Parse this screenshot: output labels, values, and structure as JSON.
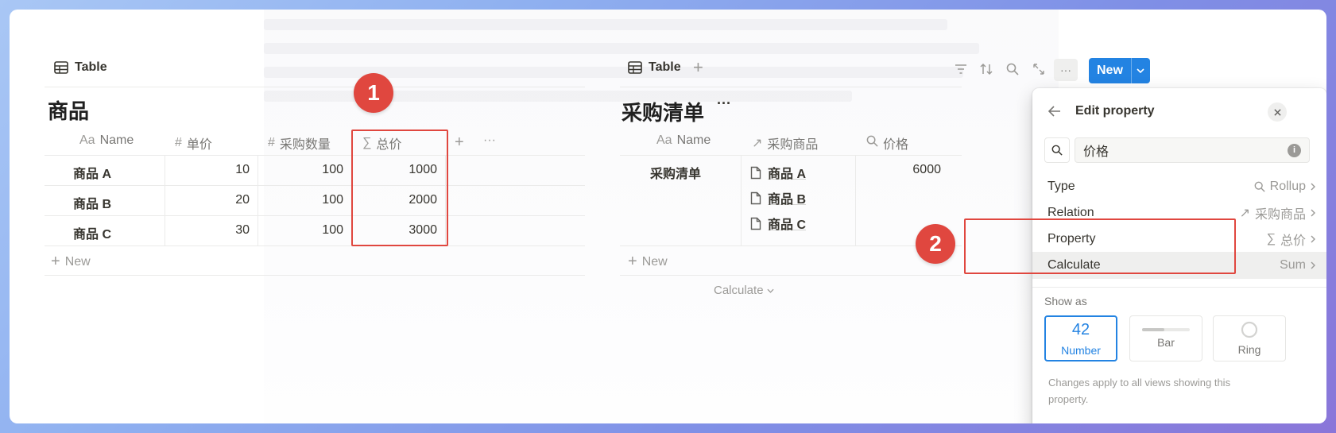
{
  "left": {
    "view_tab": "Table",
    "title": "商品",
    "columns": [
      {
        "icon": "Aa",
        "label": "Name"
      },
      {
        "icon": "#",
        "label": "单价"
      },
      {
        "icon": "#",
        "label": "采购数量"
      },
      {
        "icon": "∑",
        "label": "总价"
      }
    ],
    "rows": [
      {
        "name": "商品 A",
        "price": "10",
        "qty": "100",
        "total": "1000"
      },
      {
        "name": "商品 B",
        "price": "20",
        "qty": "100",
        "total": "2000"
      },
      {
        "name": "商品 C",
        "price": "30",
        "qty": "100",
        "total": "3000"
      }
    ],
    "add_column": "+",
    "more": "···",
    "new_row": "New",
    "badge": "1"
  },
  "right": {
    "view_tab": "Table",
    "add_view": "+",
    "title": "采购清单",
    "title_more": "···",
    "columns": [
      {
        "icon": "Aa",
        "label": "Name"
      },
      {
        "icon": "↗",
        "label": "采购商品"
      },
      {
        "icon": "search-icon",
        "label": "价格"
      }
    ],
    "row": {
      "name": "采购清单",
      "items": [
        "商品 A",
        "商品 B",
        "商品 C"
      ],
      "price": "6000"
    },
    "new_row": "New",
    "calculate": "Calculate",
    "toolbar": {
      "more": "···",
      "new_button": "New"
    },
    "badge": "2"
  },
  "popup": {
    "title": "Edit property",
    "search_value": "价格",
    "rows": [
      {
        "label": "Type",
        "value": "Rollup",
        "value_icon": "search-icon"
      },
      {
        "label": "Relation",
        "value": "采购商品",
        "value_icon": "↗"
      },
      {
        "label": "Property",
        "value": "总价",
        "value_icon": "∑"
      },
      {
        "label": "Calculate",
        "value": "Sum",
        "value_icon": ""
      }
    ],
    "show_as_label": "Show as",
    "show_as": [
      {
        "label": "Number",
        "preview": "42",
        "selected": true
      },
      {
        "label": "Bar",
        "preview": "",
        "selected": false
      },
      {
        "label": "Ring",
        "preview": "",
        "selected": false
      }
    ],
    "note": "Changes apply to all views showing this property."
  },
  "colors": {
    "accent": "#2383e2",
    "highlight_red": "#e0473f",
    "text": "#37352f",
    "muted": "#9b9a97"
  }
}
